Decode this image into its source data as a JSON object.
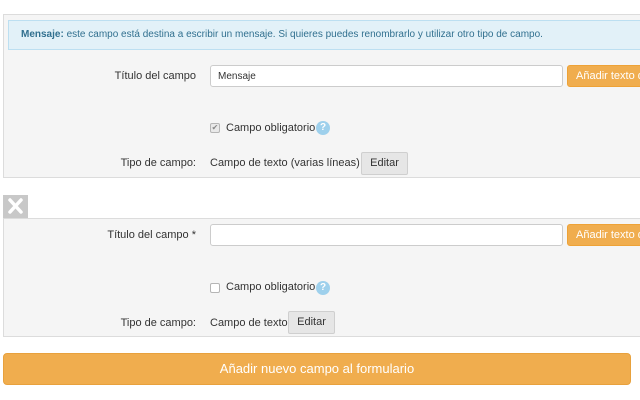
{
  "colors": {
    "accent_orange": "#f0ad4e",
    "info_background": "#e2f1f8",
    "info_text": "#31708f",
    "help_icon": "#9ed0ec",
    "panel_background": "#f5f5f5"
  },
  "field1": {
    "info_label": "Mensaje:",
    "info_text": "este campo está destina a escribir un mensaje. Si quieres puedes renombrarlo y utilizar otro tipo de campo.",
    "title_label": "Título del campo",
    "title_value": "Mensaje",
    "add_text_button": "Añadir texto d",
    "required_label": "Campo obligatorio",
    "required_checked": true,
    "help_icon": "question-circle",
    "type_label": "Tipo de campo:",
    "type_value": "Campo de texto (varias líneas)",
    "edit_button": "Editar"
  },
  "field2": {
    "remove_icon": "close-x",
    "title_label": "Título del campo *",
    "title_value": "",
    "add_text_button": "Añadir texto d",
    "required_label": "Campo obligatorio",
    "required_checked": false,
    "help_icon": "question-circle",
    "type_label": "Tipo de campo:",
    "type_value": "Campo de texto",
    "edit_button": "Editar"
  },
  "add_field_button": "Añadir nuevo campo al formulario"
}
